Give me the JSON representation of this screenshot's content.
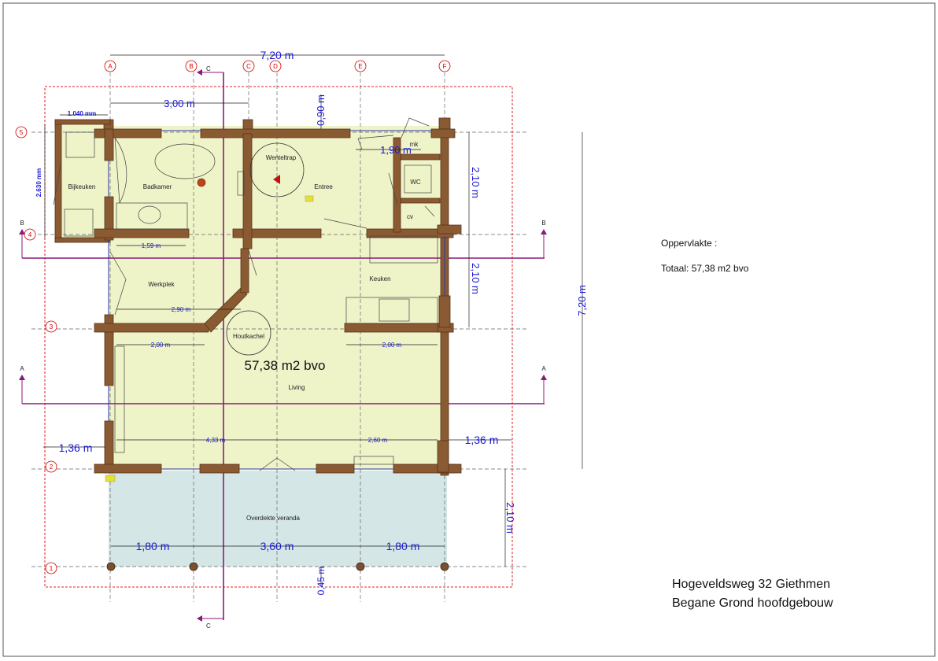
{
  "grid_axes_columns": [
    "A",
    "B",
    "C",
    "D",
    "E",
    "F"
  ],
  "grid_axes_rows": [
    "5",
    "4",
    "3",
    "2",
    "1"
  ],
  "section_markers": {
    "b": "B",
    "a": "A",
    "c": "C"
  },
  "rooms": {
    "bijkeuken": "Bijkeuken",
    "badkamer": "Badkamer",
    "penteltrap": "Wenteltrap",
    "entree": "Entree",
    "wc": "WC",
    "mk": "mk",
    "cv": "cv",
    "werkplek": "Werkplek",
    "keuken": "Keuken",
    "houtkachel": "Houtkachel",
    "living": "Living",
    "veranda": "Overdekte veranda"
  },
  "center_area": "57,38 m2 bvo",
  "dimensions": {
    "total_width": "7,20 m",
    "total_depth": "7,20 m",
    "a_to_c": "3,00 m",
    "top_offset": "0,90 m",
    "bijkeuken_width": "1.040 mm",
    "bijkeuken_depth": "2.630 mm",
    "wc_width": "1,90 m",
    "span_5_4": "2,10 m",
    "span_4_3": "2,10 m",
    "span_2_1": "2,10 m",
    "werkplek_width": "1,59 m",
    "werkplek_wall": "2,90 m",
    "living_left": "2,00 m",
    "keuken_wall": "2,00 m",
    "living_width": "4,33 m",
    "living_right": "2,60 m",
    "left_overhang": "1,36 m",
    "right_overhang": "1,36 m",
    "veranda_left": "1,80 m",
    "veranda_mid": "3,60 m",
    "veranda_right": "1,80 m",
    "bottom_offset": "0,45 m"
  },
  "info": {
    "title": "Oppervlakte :",
    "total": "Totaal: 57,38 m2 bvo",
    "address": "Hogeveldsweg 32 Giethmen",
    "floor": "Begane Grond hoofdgebouw"
  },
  "colors": {
    "floor_fill": "#eef3c8",
    "veranda_fill": "#d4e6e6",
    "wall_fill": "#8a5a32",
    "wall_stroke": "#5a3418",
    "dimension_text": "#1a1ad4",
    "grid_red": "#d40000",
    "section_line": "#8b1a7a"
  }
}
